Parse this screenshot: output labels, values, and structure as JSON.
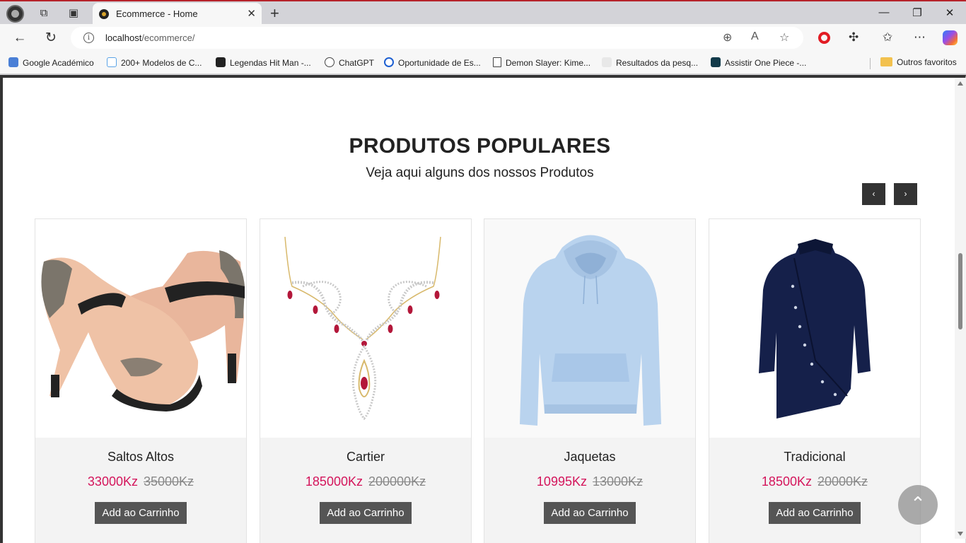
{
  "browser": {
    "tab_title": "Ecommerce - Home",
    "url_host": "localhost",
    "url_path": "/ecommerce/",
    "new_tab_symbol": "+",
    "close_symbol": "✕"
  },
  "bookmarks": [
    {
      "label": "Google Académico",
      "icon": "graduation-cap-icon"
    },
    {
      "label": "200+ Modelos de C...",
      "icon": "resume-site-icon"
    },
    {
      "label": "Legendas Hit Man -...",
      "icon": "os-icon"
    },
    {
      "label": "ChatGPT",
      "icon": "chatgpt-icon"
    },
    {
      "label": "Oportunidade de Es...",
      "icon": "circle-logo-icon"
    },
    {
      "label": "Demon Slayer: Kime...",
      "icon": "page-icon"
    },
    {
      "label": "Resultados da pesq...",
      "icon": "search-results-icon"
    },
    {
      "label": "Assistir One Piece -...",
      "icon": "flame-icon"
    }
  ],
  "other_favorites": "Outros favoritos",
  "section": {
    "title": "PRODUTOS POPULARES",
    "subtitle": "Veja aqui alguns dos nossos Produtos",
    "prev_symbol": "‹",
    "next_symbol": "›"
  },
  "products": [
    {
      "name": "Saltos Altos",
      "price": "33000Kz",
      "old_price": "35000Kz",
      "button": "Add ao Carrinho",
      "image": "high-heels-image"
    },
    {
      "name": "Cartier",
      "price": "185000Kz",
      "old_price": "200000Kz",
      "button": "Add ao Carrinho",
      "image": "necklace-image"
    },
    {
      "name": "Jaquetas",
      "price": "10995Kz",
      "old_price": "13000Kz",
      "button": "Add ao Carrinho",
      "image": "hoodie-image"
    },
    {
      "name": "Tradicional",
      "price": "18500Kz",
      "old_price": "20000Kz",
      "button": "Add ao Carrinho",
      "image": "shirt-image"
    }
  ],
  "colors": {
    "price": "#d4155b",
    "button": "#555555",
    "nav_arrow": "#333333"
  }
}
